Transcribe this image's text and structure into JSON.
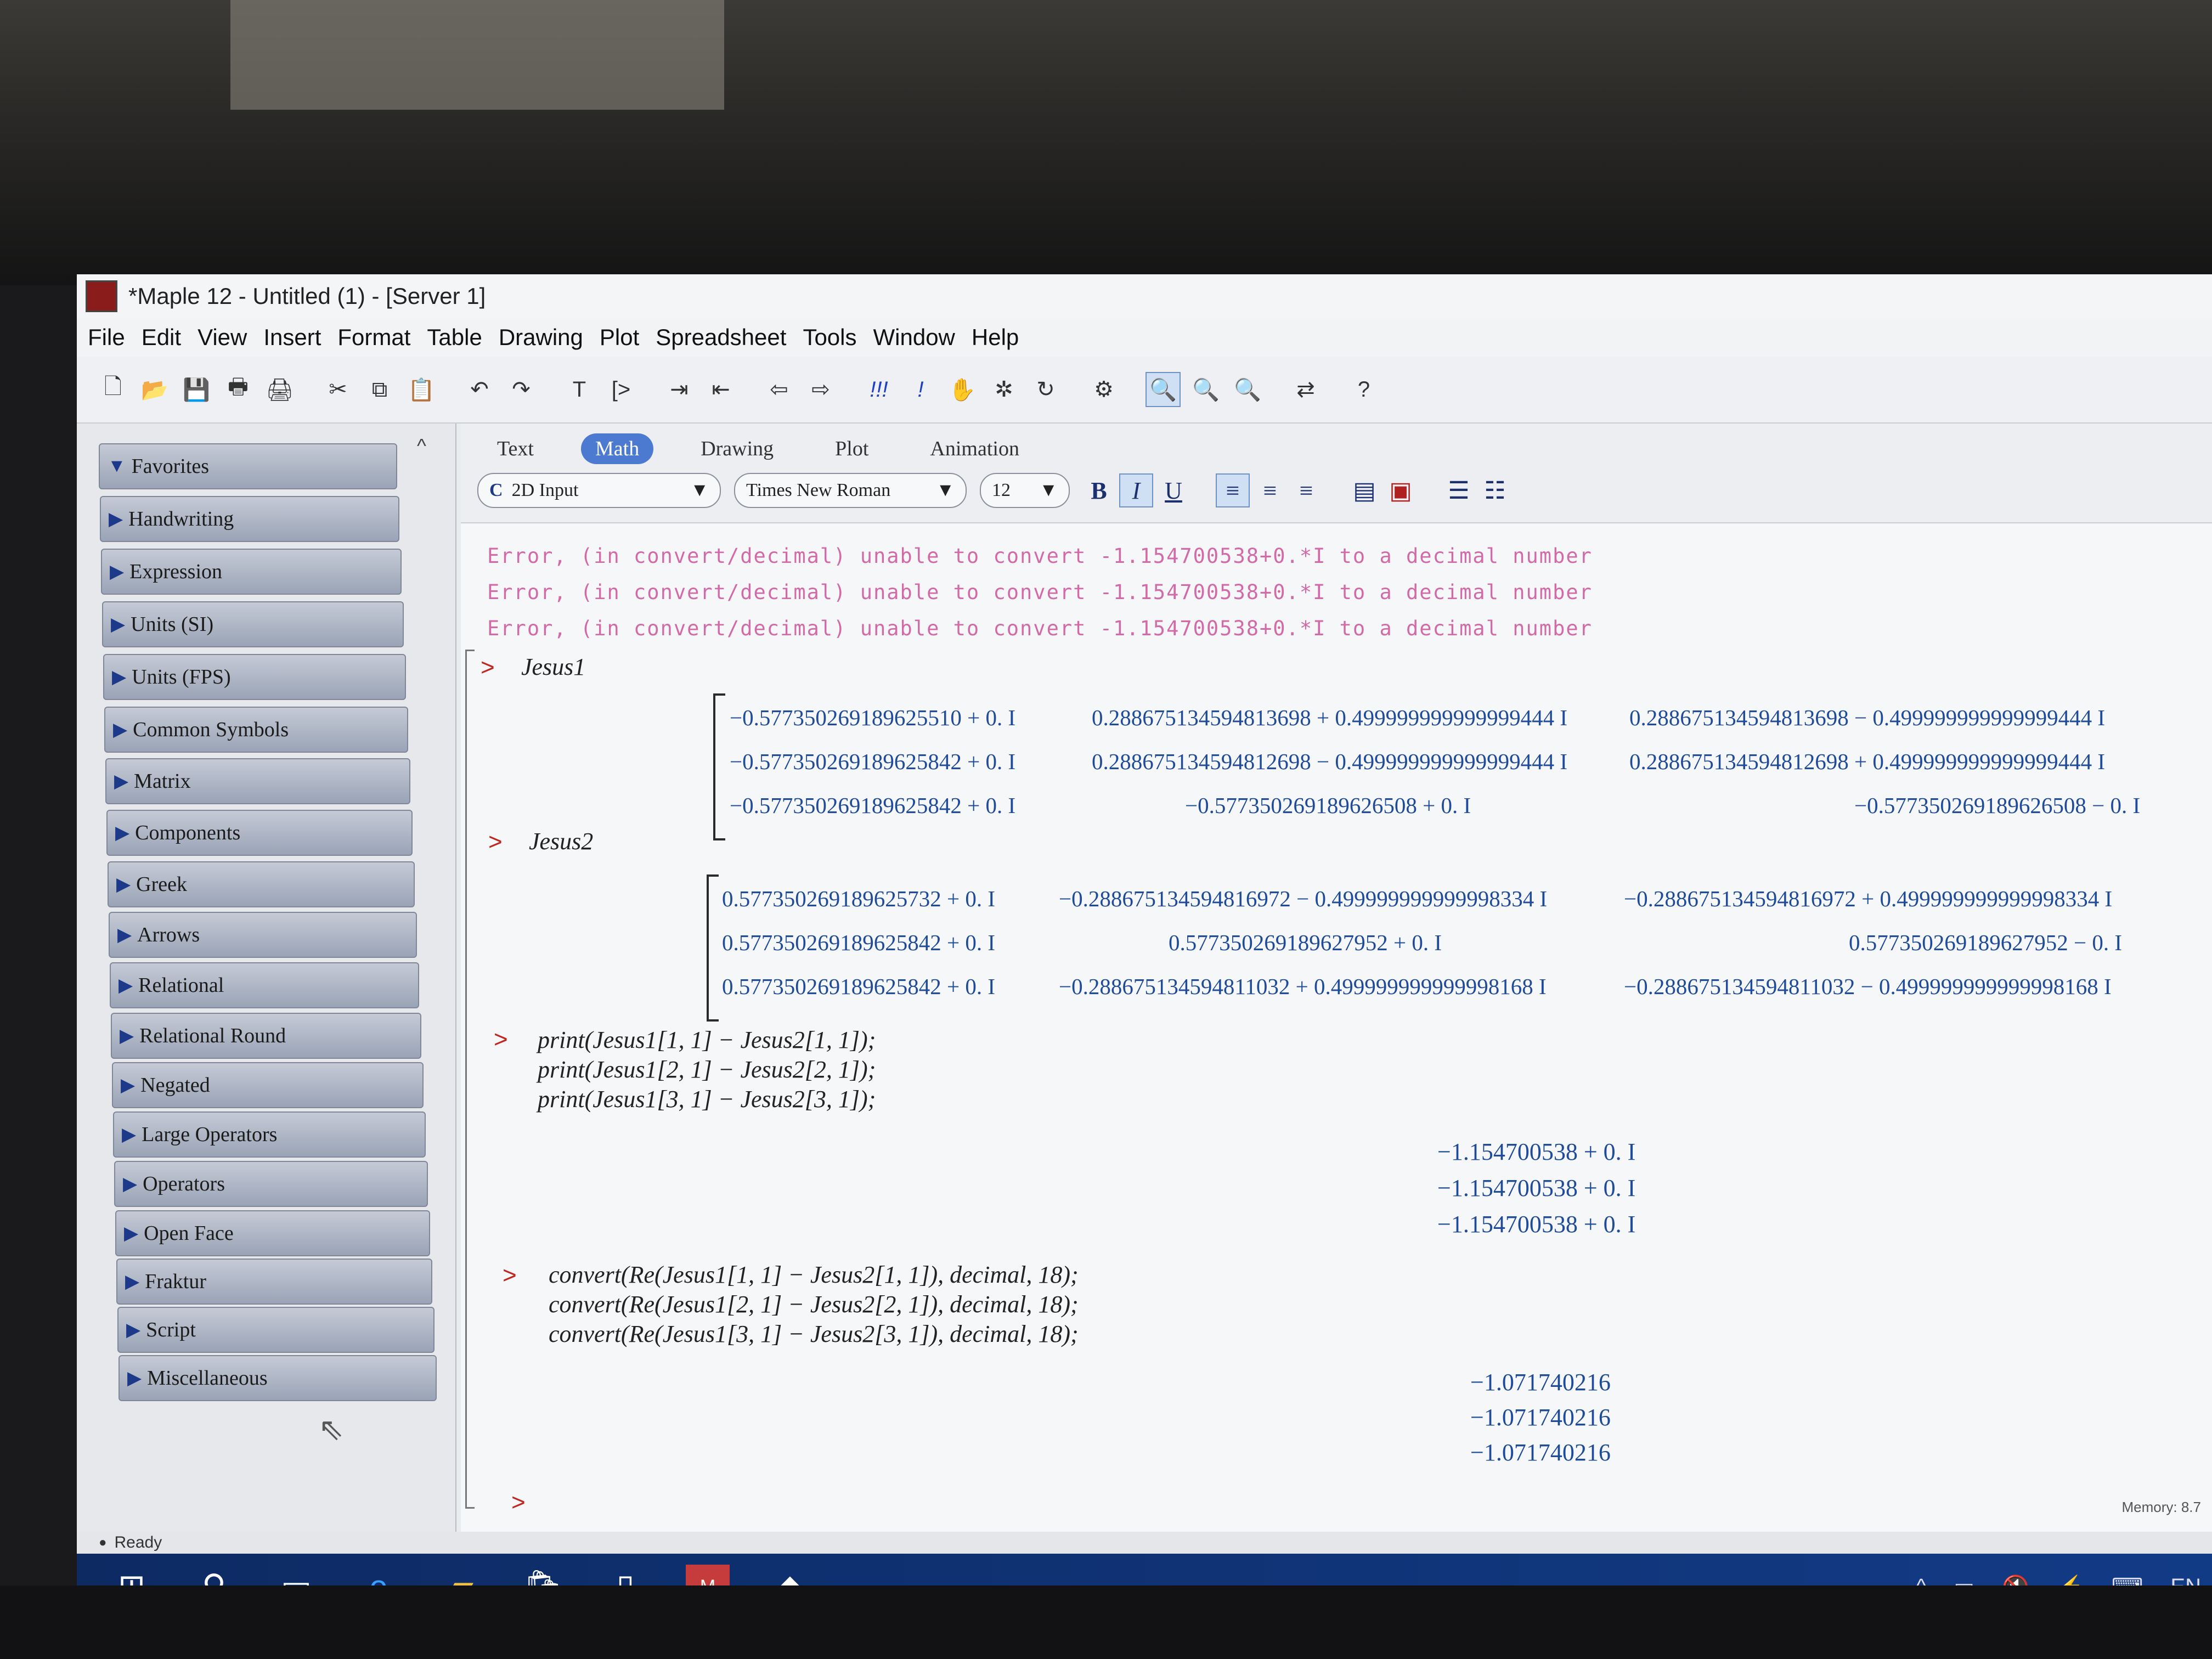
{
  "window": {
    "title": "*Maple 12 - Untitled (1) - [Server 1]"
  },
  "menu": [
    "File",
    "Edit",
    "View",
    "Insert",
    "Format",
    "Table",
    "Drawing",
    "Plot",
    "Spreadsheet",
    "Tools",
    "Window",
    "Help"
  ],
  "palettes": [
    "Favorites",
    "Handwriting",
    "Expression",
    "Units (SI)",
    "Units (FPS)",
    "Common Symbols",
    "Matrix",
    "Components",
    "Greek",
    "Arrows",
    "Relational",
    "Relational Round",
    "Negated",
    "Large Operators",
    "Operators",
    "Open Face",
    "Fraktur",
    "Script",
    "Miscellaneous"
  ],
  "context": {
    "tabs": [
      "Text",
      "Math",
      "Drawing",
      "Plot",
      "Animation"
    ],
    "input_mode": "2D Input",
    "font": "Times New Roman",
    "size": "12"
  },
  "errors": [
    "Error, (in convert/decimal) unable to convert -1.154700538+0.*I to a decimal number",
    "Error, (in convert/decimal) unable to convert -1.154700538+0.*I to a decimal number",
    "Error, (in convert/decimal) unable to convert -1.154700538+0.*I to a decimal number"
  ],
  "cmd1": "Jesus1",
  "matrix1": [
    [
      "−0.577350269189625510 + 0. I",
      "0.288675134594813698 + 0.499999999999999444 I",
      "0.288675134594813698 − 0.499999999999999444 I"
    ],
    [
      "−0.577350269189625842 + 0. I",
      "0.288675134594812698 − 0.499999999999999444 I",
      "0.288675134594812698 + 0.499999999999999444 I"
    ],
    [
      "−0.577350269189625842 + 0. I",
      "−0.577350269189626508 + 0. I",
      "−0.577350269189626508 − 0. I"
    ]
  ],
  "cmd2": "Jesus2",
  "matrix2": [
    [
      "0.577350269189625732 + 0. I",
      "−0.288675134594816972 − 0.499999999999998334 I",
      "−0.288675134594816972 + 0.499999999999998334 I"
    ],
    [
      "0.577350269189625842 + 0. I",
      "0.577350269189627952 + 0. I",
      "0.577350269189627952 − 0. I"
    ],
    [
      "0.577350269189625842 + 0. I",
      "−0.288675134594811032 + 0.499999999999998168 I",
      "−0.288675134594811032 − 0.499999999999998168 I"
    ]
  ],
  "cmd3": [
    "print(Jesus1[1, 1] − Jesus2[1, 1]);",
    "print(Jesus1[2, 1] − Jesus2[2, 1]);",
    "print(Jesus1[3, 1] − Jesus2[3, 1]);"
  ],
  "out3": [
    "−1.154700538 + 0. I",
    "−1.154700538 + 0. I",
    "−1.154700538 + 0. I"
  ],
  "cmd4": [
    "convert(Re(Jesus1[1, 1] − Jesus2[1, 1]), decimal, 18);",
    "convert(Re(Jesus1[2, 1] − Jesus2[2, 1]), decimal, 18);",
    "convert(Re(Jesus1[3, 1] − Jesus2[3, 1]), decimal, 18);"
  ],
  "out4": [
    "−1.071740216",
    "−1.071740216",
    "−1.071740216"
  ],
  "status": "Ready",
  "memory": "Memory: 8.7",
  "tray_lang": "EN"
}
